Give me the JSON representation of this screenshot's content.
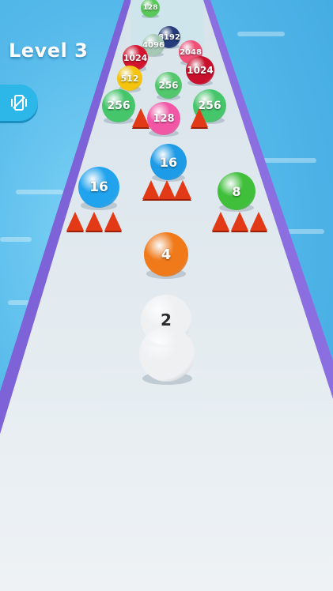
{
  "hud": {
    "level_label": "Level 3",
    "vibration_icon": "vibration-phone-icon"
  },
  "colors": {
    "water": "#55b9ea",
    "track": "#e6ecf1",
    "rail": "#8b6fe0",
    "spike": "#e23a16",
    "button": "#2db6e8"
  },
  "balls": [
    {
      "label": "16",
      "color": "#21a3ee"
    },
    {
      "label": "8",
      "color": "#3fbf3a"
    },
    {
      "label": "16",
      "color": "#1e9be6"
    },
    {
      "label": "4",
      "color": "#f07a1a"
    },
    {
      "label": "2",
      "color": "#eef0f2"
    },
    {
      "label": "",
      "color": "#eef0f2"
    },
    {
      "label": "256",
      "color": "#46c66a"
    },
    {
      "label": "256",
      "color": "#46c66a"
    },
    {
      "label": "256",
      "color": "#52c76b"
    },
    {
      "label": "128",
      "color": "#f257a6"
    },
    {
      "label": "1024",
      "color": "#d4142f"
    },
    {
      "label": "1024",
      "color": "#c8102c"
    },
    {
      "label": "2048",
      "color": "#f05277"
    },
    {
      "label": "512",
      "color": "#f4c40e"
    },
    {
      "label": "4096",
      "color": "#a6c9b6"
    },
    {
      "label": "8192",
      "color": "#253a7a"
    },
    {
      "label": "128",
      "color": "#5ac85a"
    }
  ]
}
